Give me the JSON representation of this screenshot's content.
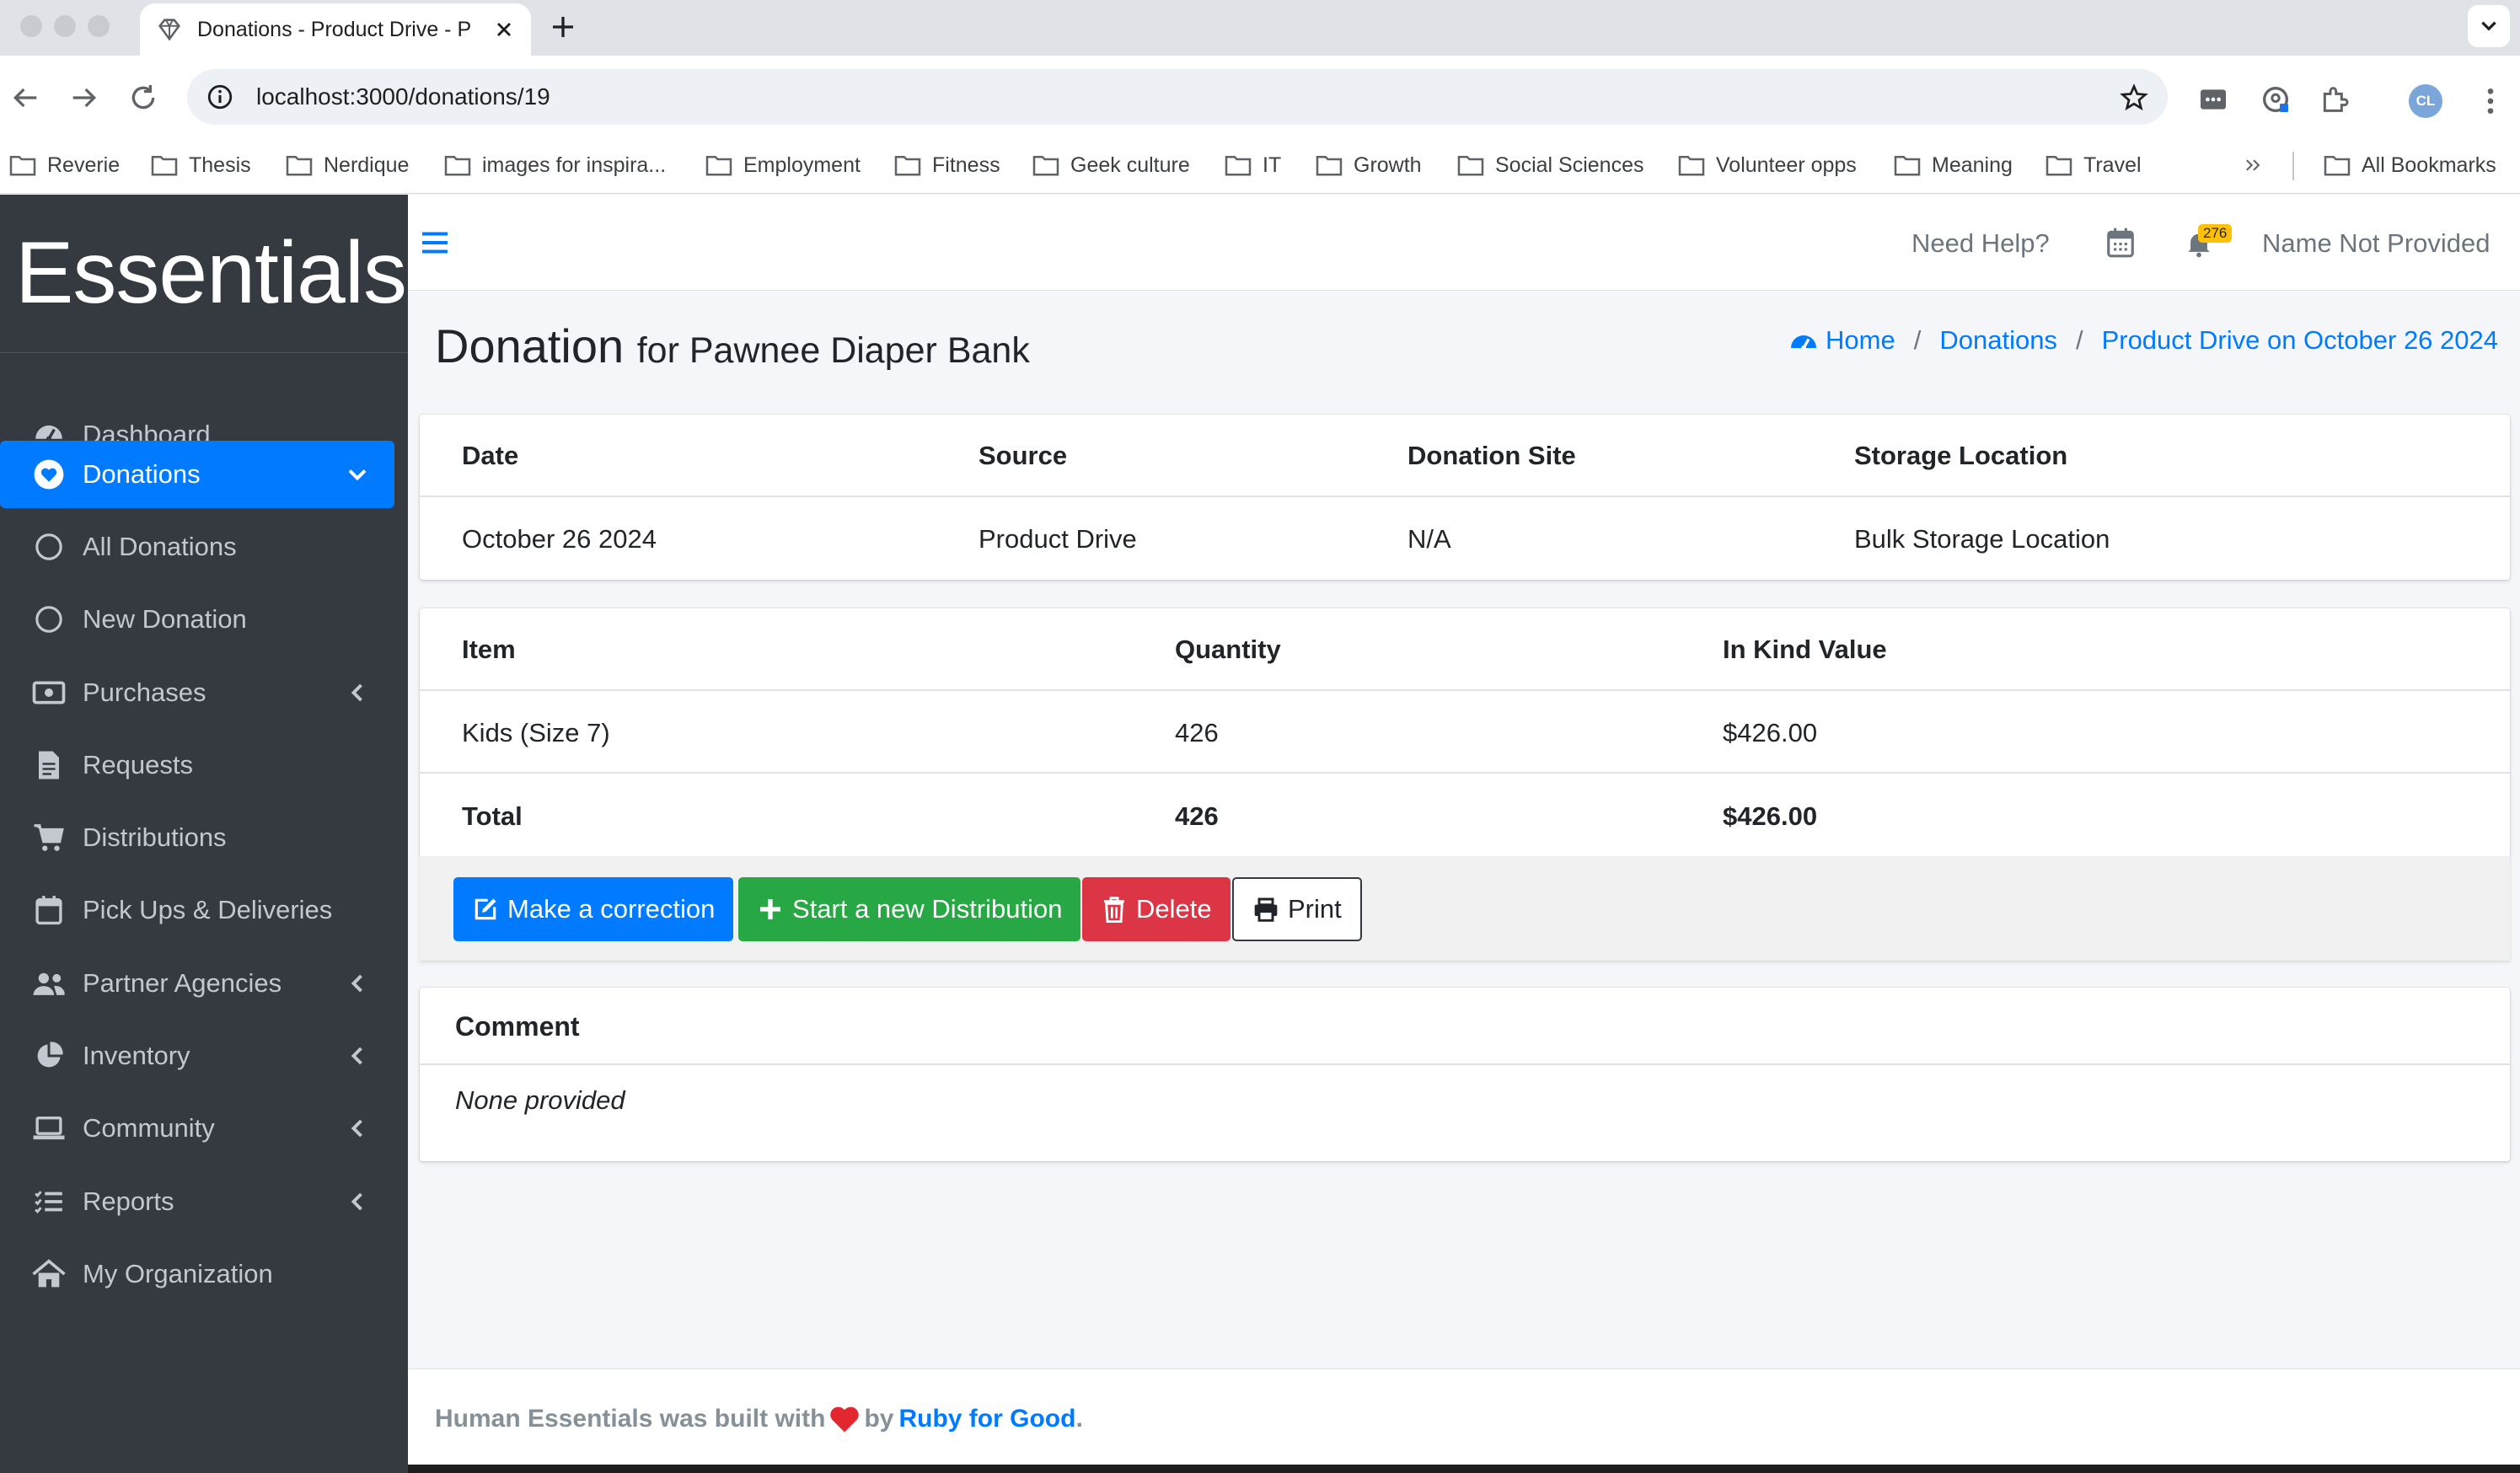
{
  "browser": {
    "tab_title": "Donations - Product Drive - P",
    "url": "localhost:3000/donations/19",
    "profile_initials": "CL",
    "bookmarks": [
      "Reverie",
      "Thesis",
      "Nerdique",
      "images for inspira...",
      "Employment",
      "Fitness",
      "Geek culture",
      "IT",
      "Growth",
      "Social Sciences",
      "Volunteer opps",
      "Meaning",
      "Travel"
    ],
    "all_bookmarks": "All Bookmarks"
  },
  "sidebar": {
    "brand": "Essentials",
    "items": [
      {
        "label": "Dashboard",
        "icon": "tachometer-icon"
      },
      {
        "label": "Donations",
        "icon": "heart-icon",
        "active": true
      },
      {
        "label": "All Donations",
        "icon": "circle-icon"
      },
      {
        "label": "New Donation",
        "icon": "circle-icon"
      },
      {
        "label": "Purchases",
        "icon": "money-bill-icon"
      },
      {
        "label": "Requests",
        "icon": "file-icon"
      },
      {
        "label": "Distributions",
        "icon": "cart-icon"
      },
      {
        "label": "Pick Ups & Deliveries",
        "icon": "calendar-icon"
      },
      {
        "label": "Partner Agencies",
        "icon": "users-icon"
      },
      {
        "label": "Inventory",
        "icon": "pie-chart-icon"
      },
      {
        "label": "Community",
        "icon": "laptop-icon"
      },
      {
        "label": "Reports",
        "icon": "list-icon"
      },
      {
        "label": "My Organization",
        "icon": "home-icon"
      }
    ]
  },
  "topnav": {
    "help": "Need Help?",
    "notifications_count": "276",
    "user_name": "Name Not Provided"
  },
  "page": {
    "title": "Donation",
    "subtitle": "for Pawnee Diaper Bank",
    "breadcrumb": [
      "Home",
      "Donations",
      "Product Drive on October 26 2024"
    ]
  },
  "summary": {
    "headers": [
      "Date",
      "Source",
      "Donation Site",
      "Storage Location"
    ],
    "values": [
      "October 26 2024",
      "Product Drive",
      "N/A",
      "Bulk Storage Location"
    ]
  },
  "items_table": {
    "headers": [
      "Item",
      "Quantity",
      "In Kind Value"
    ],
    "rows": [
      [
        "Kids (Size 7)",
        "426",
        "$426.00"
      ]
    ],
    "total": [
      "Total",
      "426",
      "$426.00"
    ]
  },
  "actions": {
    "correction": "Make a correction",
    "new_distribution": "Start a new Distribution",
    "delete": "Delete",
    "print": "Print"
  },
  "comment": {
    "title": "Comment",
    "body": "None provided"
  },
  "footer": {
    "prefix": "Human Essentials was built with",
    "by": "by",
    "link": "Ruby for Good",
    "suffix": "."
  },
  "colors": {
    "sidebar_bg": "#343a40",
    "primary": "#007bff",
    "success": "#28a745",
    "danger": "#dc3545",
    "badge": "#ffc107"
  }
}
